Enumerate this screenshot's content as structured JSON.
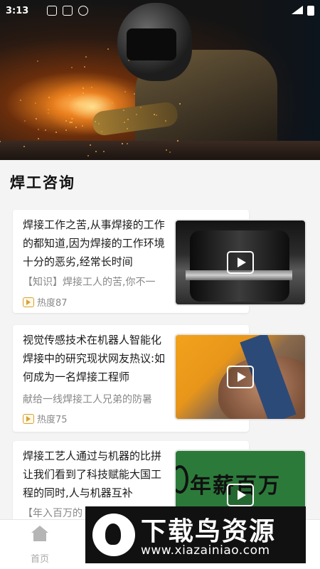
{
  "status_bar": {
    "time": "3:13"
  },
  "section": {
    "title": "焊工咨询"
  },
  "articles": [
    {
      "title": "焊接工作之苦,从事焊接的工作的都知道,因为焊接的工作环境十分的恶劣,经常长时间",
      "subtitle": "【知识】焊接工人的苦,你不一",
      "heat": "热度87",
      "thumb_icon": "play-icon"
    },
    {
      "title": "视觉传感技术在机器人智能化焊接中的研究现状网友热议:如何成为一名焊接工程师",
      "subtitle": "献给一线焊接工人兄弟的防暑",
      "heat": "热度75",
      "thumb_icon": "play-icon"
    },
    {
      "title": "焊接工艺人通过与机器的比拼让我们看到了科技赋能大国工程的同时,人与机器互补",
      "subtitle": "【年入百万的",
      "thumb_text": "年薪百万",
      "thumb_icon": "play-icon"
    }
  ],
  "bottom_nav": {
    "home_label": "首页"
  },
  "watermark": {
    "title": "下载鸟资源",
    "url": "www.xiazainiao.com"
  },
  "colors": {
    "heat_icon": "#d6a13a",
    "thumb3_bg": "#2c7a3a",
    "watermark_bg": "#111111"
  }
}
